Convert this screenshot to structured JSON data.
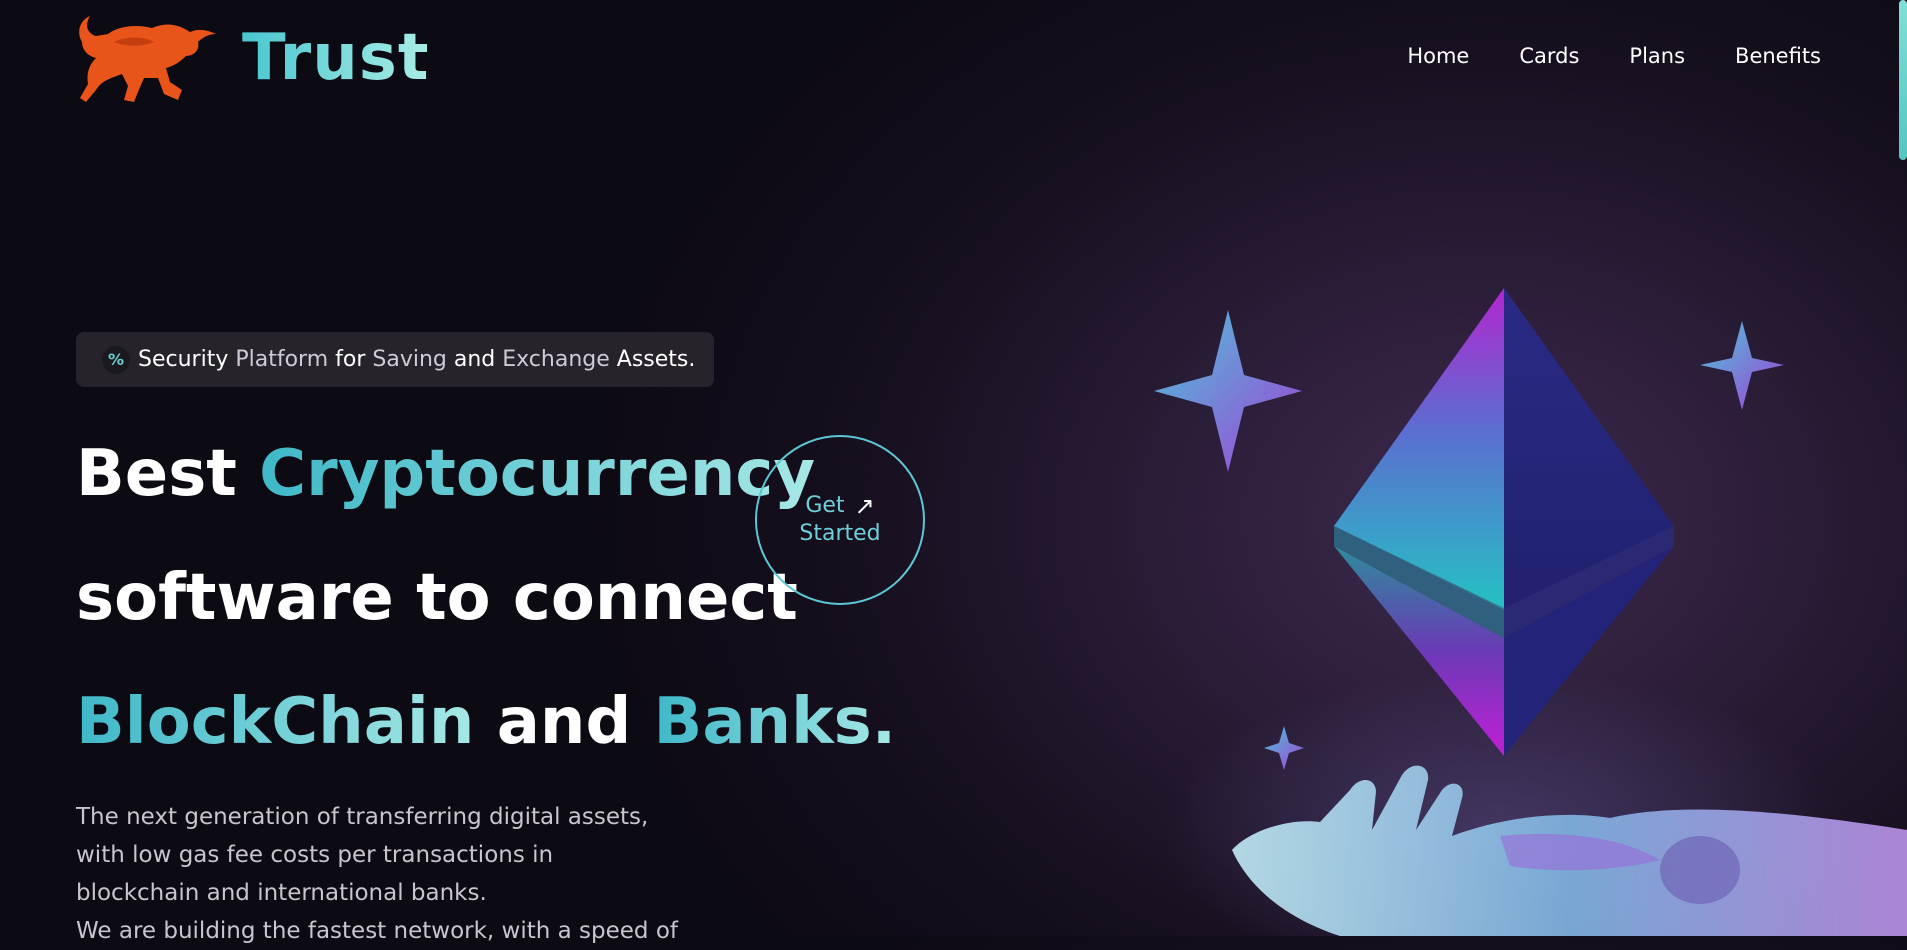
{
  "brand": {
    "name": "Trust",
    "logo_icon": "bull-icon"
  },
  "nav": {
    "items": [
      "Home",
      "Cards",
      "Plans",
      "Benefits"
    ]
  },
  "badge": {
    "icon": "percent-icon",
    "icon_glyph": "%",
    "words": [
      "Security",
      "Platform",
      "for",
      "Saving",
      "and",
      "Exchange",
      "Assets."
    ]
  },
  "headline": {
    "w1": "Best",
    "t1": "Cryptocurrency",
    "w2": "software to connect",
    "t2": "BlockChain",
    "w3": "and",
    "t3": "Banks."
  },
  "cta": {
    "line1": "Get",
    "line2": "Started",
    "icon": "arrow-up-right-icon",
    "icon_glyph": "↗"
  },
  "description": {
    "lines": [
      "The next generation of transferring digital assets,",
      "with low gas fee costs per transactions in",
      "blockchain and international banks.",
      "We are building the fastest network, with a speed of"
    ]
  },
  "illustration": {
    "icons": [
      "ethereum-icon",
      "sparkle-icon",
      "robot-hand-icon"
    ]
  },
  "colors": {
    "accent": "#4ac6d0",
    "brand_orange": "#e8541a",
    "background": "#0c0a12"
  }
}
